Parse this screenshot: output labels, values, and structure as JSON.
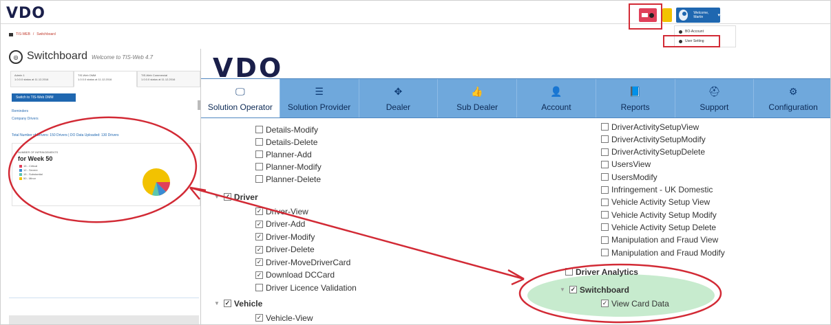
{
  "app": {
    "logo": "VDO",
    "breadcrumb": [
      "TIS-WEB",
      "Switchboard"
    ],
    "page_title": "Switchboard",
    "page_subtitle": "Welcome to TIS-Web 4.7"
  },
  "header": {
    "user_welcome": "Welcome, Martin",
    "dropdown": [
      "BO-Account",
      "User Setting"
    ]
  },
  "left_pane": {
    "tabs": [
      {
        "title": "Admin 1",
        "sub": "1.0.0.0 status at 11.12.2016"
      },
      {
        "title": "TIS-Web DMM",
        "sub": "1.0.0.0 status at 11.12.2016"
      },
      {
        "title": "TIS-Web Commercial",
        "sub": "1.0.0.0 status at 11.12.2016"
      }
    ],
    "switch_button": "Switch to TIS-Web DMM",
    "links": [
      "Reminders",
      "Company Drivers"
    ],
    "totals": "Total Number of Drivers: 150 Drivers | DO Data Uploaded: 130 Drivers",
    "infringements": {
      "kicker": "NUMBER OF INFRINGEMENTS",
      "week": "for Week 50",
      "legend": [
        {
          "label": "15 - Critical",
          "color": "#e0405a"
        },
        {
          "label": "12 - Severe",
          "color": "#3b8bd4"
        },
        {
          "label": "15 - Substantial",
          "color": "#5cc6b0"
        },
        {
          "label": "50 - Minor",
          "color": "#f2c200"
        }
      ]
    }
  },
  "nav": {
    "tabs": [
      {
        "label": "Solution Operator",
        "icon": "🖵",
        "name": "monitor-icon",
        "active": true
      },
      {
        "label": "Solution Provider",
        "icon": "☰",
        "name": "list-icon",
        "active": false
      },
      {
        "label": "Dealer",
        "icon": "✥",
        "name": "move-icon",
        "active": false
      },
      {
        "label": "Sub Dealer",
        "icon": "👍",
        "name": "thumbs-up-icon",
        "active": false
      },
      {
        "label": "Account",
        "icon": "👤",
        "name": "user-icon",
        "active": false
      },
      {
        "label": "Reports",
        "icon": "📘",
        "name": "book-icon",
        "active": false
      },
      {
        "label": "Support",
        "icon": "⛑",
        "name": "lifebuoy-icon",
        "active": false
      },
      {
        "label": "Configuration",
        "icon": "⚙",
        "name": "gear-icon",
        "active": false
      }
    ]
  },
  "permissions": {
    "left_top": [
      {
        "label": "Details-Modify",
        "checked": false
      },
      {
        "label": "Details-Delete",
        "checked": false
      },
      {
        "label": "Planner-Add",
        "checked": false
      },
      {
        "label": "Planner-Modify",
        "checked": false
      },
      {
        "label": "Planner-Delete",
        "checked": false
      }
    ],
    "driver_group": {
      "label": "Driver",
      "checked": true
    },
    "driver_items": [
      {
        "label": "Driver-View",
        "checked": true
      },
      {
        "label": "Driver-Add",
        "checked": true
      },
      {
        "label": "Driver-Modify",
        "checked": true
      },
      {
        "label": "Driver-Delete",
        "checked": true
      },
      {
        "label": "Driver-MoveDriverCard",
        "checked": true
      },
      {
        "label": "Download DCCard",
        "checked": true
      },
      {
        "label": "Driver Licence Validation",
        "checked": false
      }
    ],
    "vehicle_group": {
      "label": "Vehicle",
      "checked": true
    },
    "vehicle_items": [
      {
        "label": "Vehicle-View",
        "checked": true
      }
    ],
    "right": [
      {
        "label": "DriverActivitySetupView",
        "checked": false
      },
      {
        "label": "DriverActivitySetupModify",
        "checked": false
      },
      {
        "label": "DriverActivitySetupDelete",
        "checked": false
      },
      {
        "label": "UsersView",
        "checked": false
      },
      {
        "label": "UsersModify",
        "checked": false
      },
      {
        "label": "Infringement - UK Domestic",
        "checked": false
      },
      {
        "label": "Vehicle Activity Setup View",
        "checked": false
      },
      {
        "label": "Vehicle Activity Setup Modify",
        "checked": false
      },
      {
        "label": "Vehicle Activity Setup Delete",
        "checked": false
      },
      {
        "label": "Manipulation and Fraud View",
        "checked": false
      },
      {
        "label": "Manipulation and Fraud Modify",
        "checked": false
      }
    ],
    "driver_analytics": {
      "label": "Driver Analytics",
      "checked": false
    },
    "switchboard_group": {
      "label": "Switchboard",
      "checked": true
    },
    "switchboard_items": [
      {
        "label": "View Card Data",
        "checked": true
      }
    ]
  },
  "colors": {
    "nav_bg": "#6fa8dc",
    "accent_blue": "#1f67b0",
    "annotation_red": "#d22a35",
    "highlight_green": "#bde8c6"
  }
}
